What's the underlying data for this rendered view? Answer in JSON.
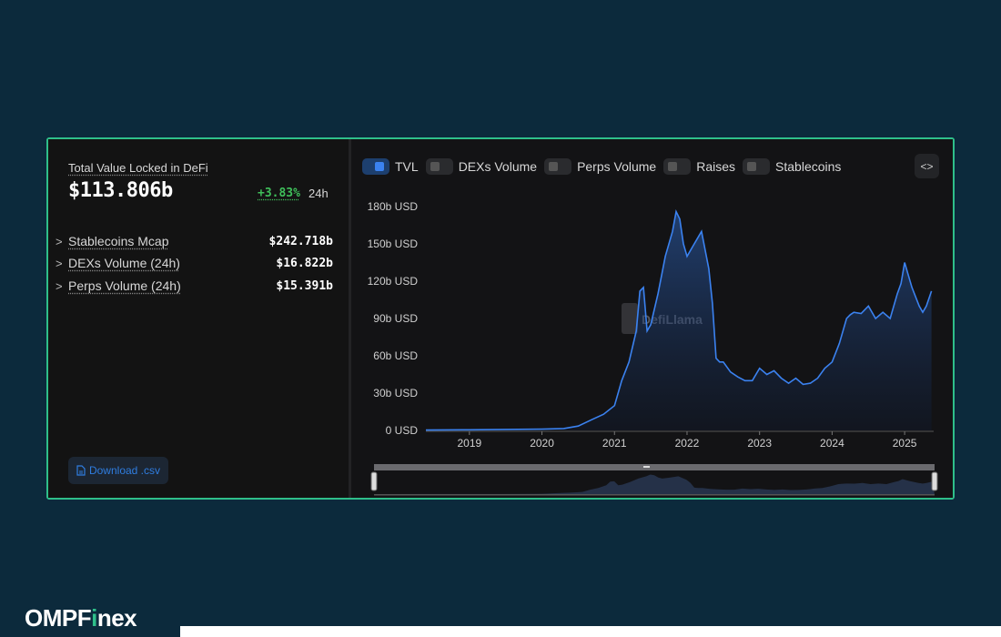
{
  "summary": {
    "title": "Total Value Locked in DeFi",
    "value": "$113.806b",
    "change": "+3.83%",
    "period": "24h"
  },
  "metrics": [
    {
      "label": "Stablecoins Mcap",
      "value": "$242.718b"
    },
    {
      "label": "DEXs Volume (24h)",
      "value": "$16.822b"
    },
    {
      "label": "Perps Volume (24h)",
      "value": "$15.391b"
    }
  ],
  "download_label": "Download .csv",
  "legend": [
    {
      "label": "TVL",
      "active": true
    },
    {
      "label": "DEXs Volume",
      "active": false
    },
    {
      "label": "Perps Volume",
      "active": false
    },
    {
      "label": "Raises",
      "active": false
    },
    {
      "label": "Stablecoins",
      "active": false
    }
  ],
  "embed_label": "<>",
  "watermark": "DefiLlama",
  "brand": {
    "prefix": "OMPF",
    "accent": "i",
    "suffix": "nex"
  },
  "colors": {
    "line": "#3b82f0",
    "accent": "#2fbf8a",
    "positive": "#3fbf5a",
    "background": "#0c2a3c"
  },
  "chart_data": {
    "type": "area",
    "series": [
      {
        "name": "TVL",
        "unit": "b USD"
      }
    ],
    "ylim": [
      0,
      180
    ],
    "yticks": [
      "0 USD",
      "30b USD",
      "60b USD",
      "90b USD",
      "120b USD",
      "150b USD",
      "180b USD"
    ],
    "xticks": [
      "2019",
      "2020",
      "2021",
      "2022",
      "2023",
      "2024",
      "2025"
    ],
    "x": [
      2018.4,
      2019.0,
      2019.5,
      2020.0,
      2020.3,
      2020.5,
      2020.7,
      2020.85,
      2021.0,
      2021.1,
      2021.2,
      2021.3,
      2021.35,
      2021.4,
      2021.45,
      2021.5,
      2021.6,
      2021.7,
      2021.8,
      2021.85,
      2021.9,
      2021.95,
      2022.0,
      2022.1,
      2022.2,
      2022.3,
      2022.35,
      2022.4,
      2022.45,
      2022.5,
      2022.6,
      2022.7,
      2022.8,
      2022.9,
      2023.0,
      2023.1,
      2023.2,
      2023.3,
      2023.4,
      2023.5,
      2023.6,
      2023.7,
      2023.8,
      2023.9,
      2024.0,
      2024.1,
      2024.2,
      2024.25,
      2024.3,
      2024.4,
      2024.5,
      2024.6,
      2024.7,
      2024.8,
      2024.9,
      2024.95,
      2025.0,
      2025.05,
      2025.1,
      2025.2,
      2025.25,
      2025.3,
      2025.37
    ],
    "y": [
      0.3,
      0.5,
      0.8,
      1.0,
      1.5,
      3.5,
      9,
      13,
      20,
      40,
      55,
      80,
      112,
      115,
      80,
      85,
      110,
      140,
      160,
      176,
      170,
      150,
      140,
      150,
      160,
      130,
      102,
      58,
      55,
      55,
      47,
      43,
      40,
      40,
      50,
      45,
      48,
      42,
      38,
      42,
      37,
      38,
      42,
      50,
      55,
      70,
      90,
      93,
      95,
      94,
      100,
      90,
      95,
      90,
      110,
      118,
      135,
      125,
      115,
      100,
      95,
      100,
      112
    ]
  }
}
